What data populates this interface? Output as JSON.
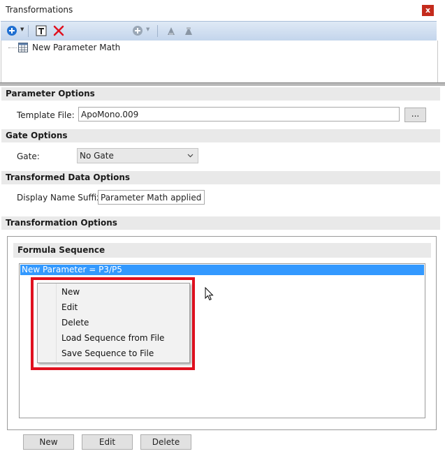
{
  "window": {
    "title": "Transformations",
    "close_label": "x"
  },
  "toolbar": {
    "icons": [
      "add-icon",
      "text-format-icon",
      "delete-icon",
      "add-disabled-icon",
      "move-up-icon",
      "move-down-icon"
    ]
  },
  "tree": {
    "item_label": "New Parameter Math"
  },
  "parameter_options": {
    "header": "Parameter Options",
    "template_label": "Template File:",
    "template_value": "ApoMono.009",
    "browse_label": "..."
  },
  "gate_options": {
    "header": "Gate Options",
    "gate_label": "Gate:",
    "gate_value": "No Gate"
  },
  "transformed_data_options": {
    "header": "Transformed Data Options",
    "suffix_label": "Display Name Suffix",
    "suffix_value": "Parameter Math applied"
  },
  "transformation_options": {
    "header": "Transformation Options"
  },
  "formula_sequence": {
    "header": "Formula Sequence",
    "items": [
      "New Parameter = P3/P5"
    ]
  },
  "context_menu": {
    "items": [
      "New",
      "Edit",
      "Delete",
      "Load Sequence from File",
      "Save Sequence to File"
    ]
  },
  "bottom_buttons": {
    "new": "New",
    "edit": "Edit",
    "delete": "Delete"
  },
  "colors": {
    "selection": "#3399ff",
    "highlight_border": "#e0111f",
    "close_button": "#c42b1c"
  }
}
